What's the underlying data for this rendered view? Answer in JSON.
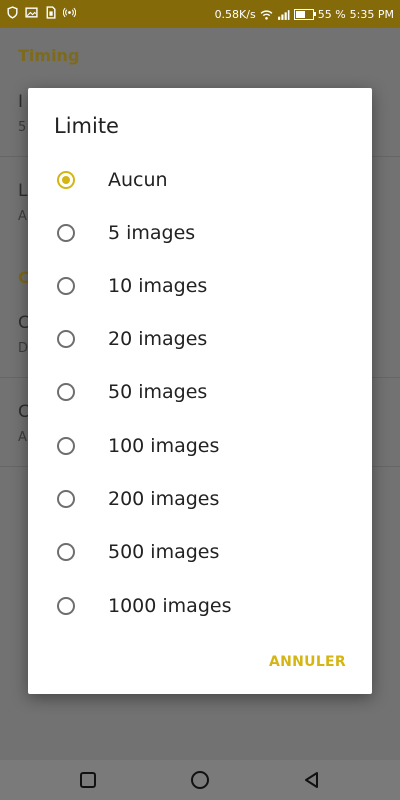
{
  "status_bar": {
    "speed": "0.58K/s",
    "battery": "55 %",
    "battery_level": 0.55,
    "time": "5:35 PM",
    "icons": [
      "shield-icon",
      "image-icon",
      "sim-icon",
      "broadcast-icon",
      "wifi-icon",
      "signal-icon",
      "battery-icon"
    ]
  },
  "background": {
    "section1": "Timing",
    "row1_title": "I",
    "row1_sub": "5",
    "row2_title": "L",
    "row2_sub": "A",
    "section2": "C",
    "row3_title": "C",
    "row3_sub": "D",
    "row4_title": "C",
    "row4_sub": "A"
  },
  "dialog": {
    "title": "Limite",
    "options": [
      {
        "label": "Aucun",
        "selected": true
      },
      {
        "label": "5 images",
        "selected": false
      },
      {
        "label": "10 images",
        "selected": false
      },
      {
        "label": "20 images",
        "selected": false
      },
      {
        "label": "50 images",
        "selected": false
      },
      {
        "label": "100 images",
        "selected": false
      },
      {
        "label": "200 images",
        "selected": false
      },
      {
        "label": "500 images",
        "selected": false
      },
      {
        "label": "1000 images",
        "selected": false
      }
    ],
    "cancel_label": "ANNULER"
  },
  "colors": {
    "status_bar": "#846a08",
    "accent": "#d4b513"
  },
  "nav_bar": {
    "icons": [
      "recents-icon",
      "home-icon",
      "back-icon"
    ]
  }
}
